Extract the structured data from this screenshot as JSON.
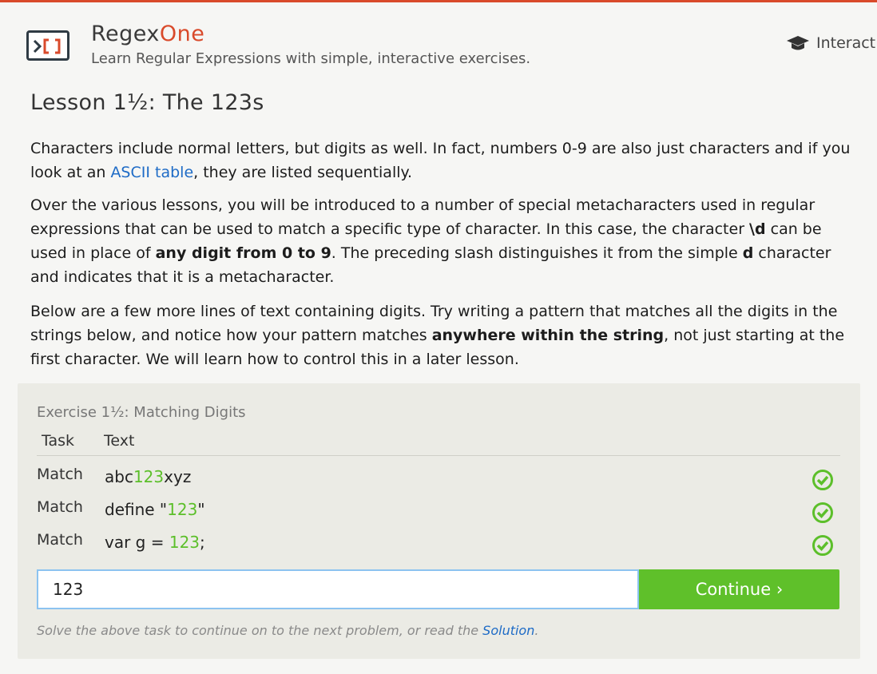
{
  "header": {
    "brand_main": "Regex",
    "brand_accent": "One",
    "tagline": "Learn Regular Expressions with simple, interactive exercises.",
    "nav_interactive": "Interact",
    "accent_color": "#d94a2b"
  },
  "lesson": {
    "title": "Lesson 1½: The 123s",
    "p1": {
      "a": "Characters include normal letters, but digits as well. In fact, numbers 0-9 are also just characters and if you look at an ",
      "link": "ASCII table",
      "b": ", they are listed sequentially."
    },
    "p2": {
      "a": "Over the various lessons, you will be introduced to a number of special metacharacters used in regular expressions that can be used to match a specific type of character. In this case, the character ",
      "b1": "\\d",
      "b": " can be used in place of ",
      "b2": "any digit from 0 to 9",
      "c": ". The preceding slash distinguishes it from the simple ",
      "b3": "d",
      "d": " character and indicates that it is a metacharacter."
    },
    "p3": {
      "a": "Below are a few more lines of text containing digits. Try writing a pattern that matches all the digits in the strings below, and notice how your pattern matches ",
      "b1": "anywhere within the string",
      "b": ", not just starting at the first character. We will learn how to control this in a later lesson."
    }
  },
  "exercise": {
    "title": "Exercise 1½: Matching Digits",
    "col_task": "Task",
    "col_text": "Text",
    "rows": [
      {
        "task": "Match",
        "pre": "abc",
        "match": "123",
        "post": "xyz",
        "status": "check-circle-icon"
      },
      {
        "task": "Match",
        "pre": "define \"",
        "match": "123",
        "post": "\"",
        "status": "check-circle-icon"
      },
      {
        "task": "Match",
        "pre": "var g = ",
        "match": "123",
        "post": ";",
        "status": "check-circle-icon"
      }
    ],
    "input_value": "123",
    "continue_label": "Continue ›",
    "hint_a": "Solve the above task to continue on to the next problem, or read the ",
    "hint_link": "Solution",
    "hint_b": ".",
    "match_color": "#5cbf2a"
  }
}
